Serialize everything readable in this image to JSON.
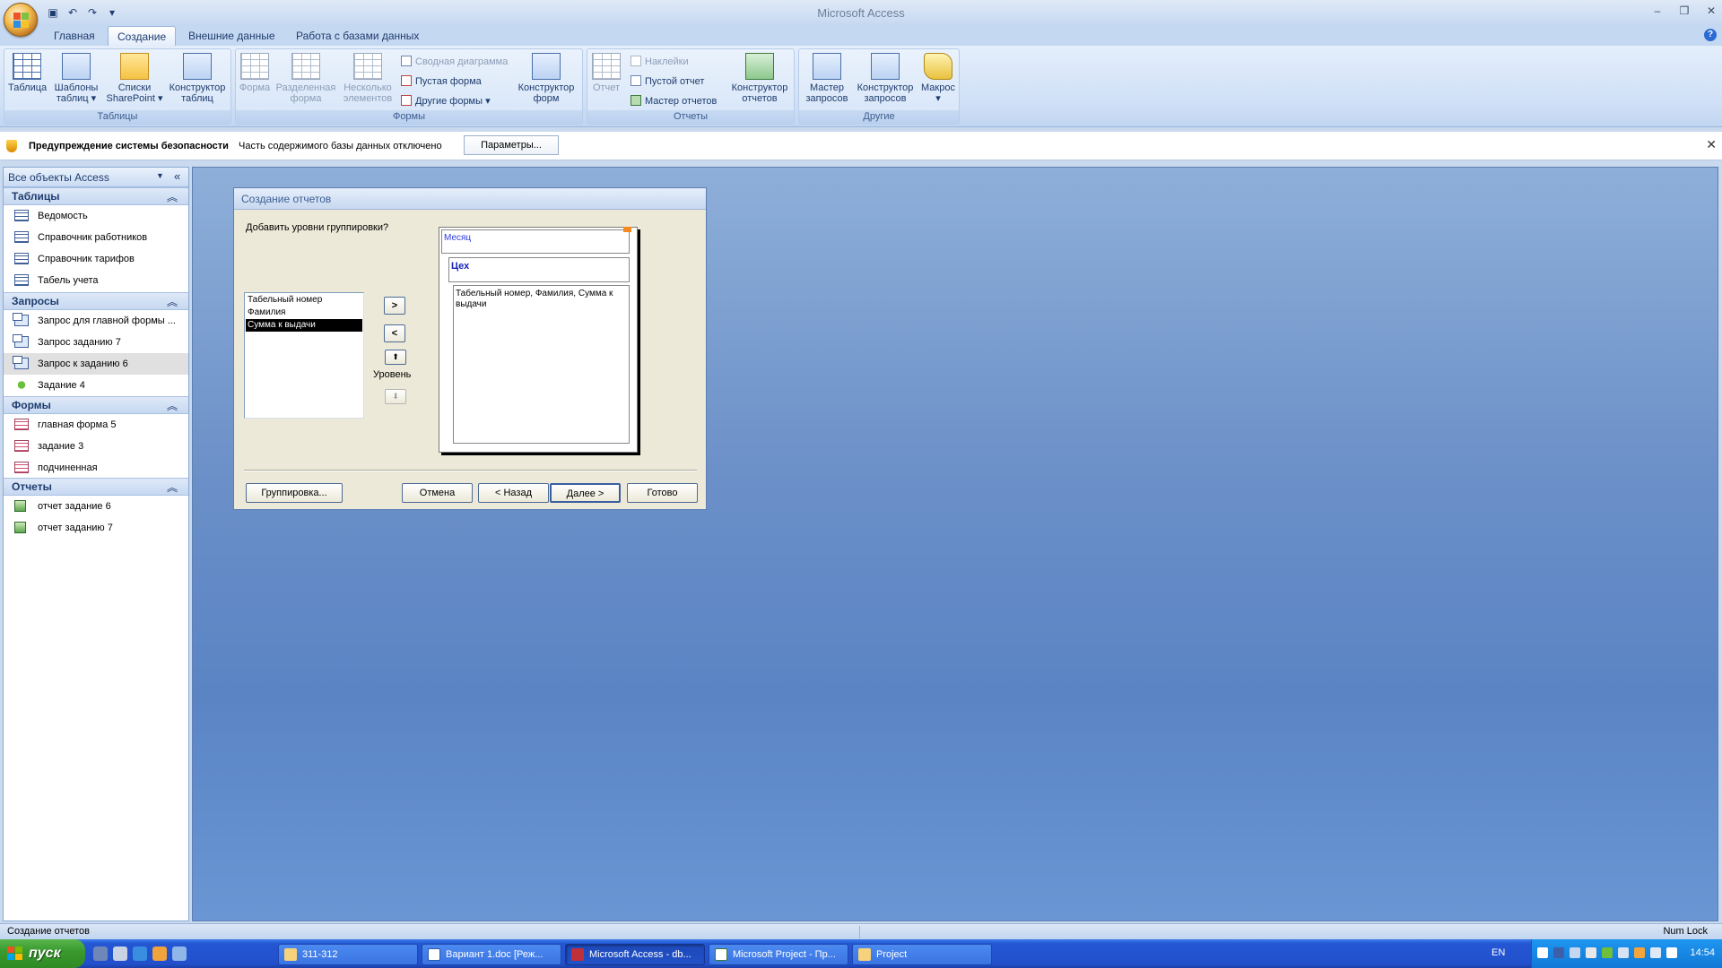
{
  "window": {
    "title": "Microsoft Access"
  },
  "qat": [
    "save-icon",
    "undo-icon",
    "redo-icon",
    "customize-icon"
  ],
  "ribbon": {
    "tabs": [
      "Главная",
      "Создание",
      "Внешние данные",
      "Работа с базами данных"
    ],
    "active_tab": "Создание",
    "groups": {
      "tables": {
        "label": "Таблицы",
        "buttons": [
          {
            "line1": "Таблица",
            "line2": ""
          },
          {
            "line1": "Шаблоны",
            "line2": "таблиц ▾"
          },
          {
            "line1": "Списки",
            "line2": "SharePoint ▾"
          },
          {
            "line1": "Конструктор",
            "line2": "таблиц"
          }
        ]
      },
      "forms": {
        "label": "Формы",
        "buttons": [
          {
            "line1": "Форма",
            "line2": ""
          },
          {
            "line1": "Разделенная",
            "line2": "форма"
          },
          {
            "line1": "Несколько",
            "line2": "элементов"
          },
          {
            "line1": "Конструктор",
            "line2": "форм"
          }
        ],
        "small": [
          "Сводная диаграмма",
          "Пустая форма",
          "Другие формы ▾"
        ]
      },
      "reports": {
        "label": "Отчеты",
        "buttons": [
          {
            "line1": "Отчет",
            "line2": ""
          },
          {
            "line1": "Конструктор",
            "line2": "отчетов"
          }
        ],
        "small": [
          "Наклейки",
          "Пустой отчет",
          "Мастер отчетов"
        ]
      },
      "other": {
        "label": "Другие",
        "buttons": [
          {
            "line1": "Мастер",
            "line2": "запросов"
          },
          {
            "line1": "Конструктор",
            "line2": "запросов"
          },
          {
            "line1": "Макрос",
            "line2": "▾"
          }
        ]
      }
    }
  },
  "security_bar": {
    "title": "Предупреждение системы безопасности",
    "text": "Часть содержимого базы данных отключено",
    "button": "Параметры..."
  },
  "nav_pane": {
    "title": "Все объекты Access",
    "categories": [
      {
        "label": "Таблицы",
        "items": [
          "Ведомость",
          "Справочник работников",
          "Справочник тарифов",
          "Табель учета"
        ]
      },
      {
        "label": "Запросы",
        "items": [
          "Запрос для главной формы ...",
          "Запрос заданию 7",
          "Запрос к заданию 6",
          "Задание 4"
        ]
      },
      {
        "label": "Формы",
        "items": [
          "главная форма 5",
          "задание 3",
          "подчиненная"
        ]
      },
      {
        "label": "Отчеты",
        "items": [
          "отчет задание 6",
          "отчет заданию 7"
        ]
      }
    ],
    "selected_item": "Запрос к заданию 6"
  },
  "dialog": {
    "title": "Создание отчетов",
    "question": "Добавить уровни группировки?",
    "fields": [
      "Табельный номер",
      "Фамилия",
      "Сумма к выдачи"
    ],
    "selected_field": "Сумма к выдачи",
    "btn_add": ">",
    "btn_remove": "<",
    "btn_up": "⬆",
    "btn_down": "⬇",
    "level_label": "Уровень",
    "preview": {
      "level1": "Месяц",
      "level2": "Цех",
      "detail": "Табельный номер, Фамилия, Сумма к выдачи"
    },
    "buttons": {
      "grouping": "Группировка...",
      "cancel": "Отмена",
      "back": "< Назад",
      "next": "Далее >",
      "finish": "Готово"
    }
  },
  "status_bar": {
    "text": "Создание отчетов",
    "numlock": "Num Lock"
  },
  "taskbar": {
    "start": "пуск",
    "tasks": [
      {
        "label": "311-312",
        "icon": "folder-icon"
      },
      {
        "label": "Вариант 1.doc [Реж...",
        "icon": "word-icon"
      },
      {
        "label": "Microsoft Access - db...",
        "icon": "access-icon"
      },
      {
        "label": "Microsoft Project - Пр...",
        "icon": "project-icon"
      },
      {
        "label": "Project",
        "icon": "folder-icon"
      }
    ],
    "active_task": "Microsoft Access - db...",
    "language": "EN",
    "clock": "14:54"
  },
  "colors": {
    "workspace": "#6a90cc",
    "ribbon": "#d6e5f8",
    "taskbar": "#2456d3",
    "tray": "#1178d6",
    "selection": "#000000"
  }
}
